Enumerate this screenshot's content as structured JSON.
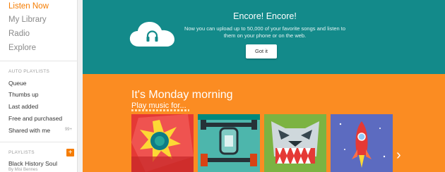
{
  "sidebar": {
    "nav": [
      {
        "label": "Listen Now",
        "active": true
      },
      {
        "label": "My Library",
        "active": false
      },
      {
        "label": "Radio",
        "active": false
      },
      {
        "label": "Explore",
        "active": false
      }
    ],
    "auto_playlists_header": "AUTO PLAYLISTS",
    "auto_playlists": [
      {
        "label": "Queue"
      },
      {
        "label": "Thumbs up"
      },
      {
        "label": "Last added"
      },
      {
        "label": "Free and purchased"
      },
      {
        "label": "Shared with me",
        "badge": "99+"
      }
    ],
    "playlists_header": "PLAYLISTS",
    "playlists": [
      {
        "label": "Black History Soul",
        "owner": "By Misi Bennes"
      }
    ],
    "add_label": "+"
  },
  "banner": {
    "title": "Encore! Encore!",
    "description": "Now you can upload up to 50,000 of your favorite songs and listen to them on your phone or on the web.",
    "button_label": "Got it",
    "icon": "cloud-headphones-icon"
  },
  "monday": {
    "title": "It's Monday morning",
    "subtitle": "Play music for...",
    "cards": [
      {
        "icon": "sunburst-art"
      },
      {
        "icon": "dumbbell-art"
      },
      {
        "icon": "wolf-art"
      },
      {
        "icon": "rocket-art"
      }
    ],
    "next_icon": "chevron-right-icon",
    "next_glyph": "›"
  },
  "colors": {
    "accent": "#f57c00",
    "banner_bg": "#138a8a",
    "monday_bg": "#fb8c22"
  }
}
